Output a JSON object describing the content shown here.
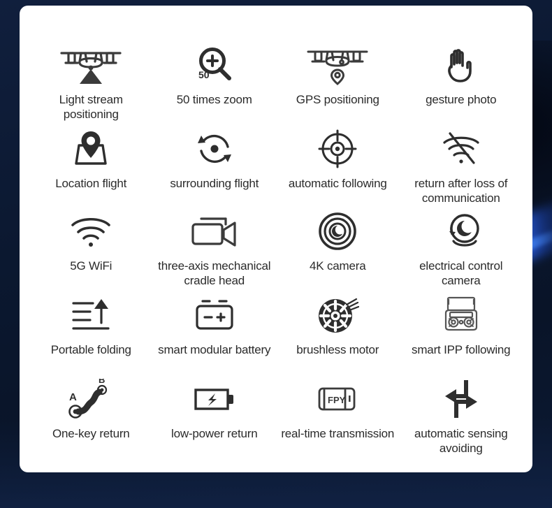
{
  "background": {
    "base_color": "#0c1a33",
    "accent_streak_color": "#2c68ff"
  },
  "card": {
    "background_color": "#ffffff",
    "text_color": "#2b2b2b"
  },
  "features": [
    {
      "icon": "drone-light-beam-icon",
      "label": "Light stream positioning"
    },
    {
      "icon": "magnifier-zoom-50-icon",
      "label": "50 times zoom",
      "badge": "50"
    },
    {
      "icon": "drone-gps-pin-icon",
      "label": "GPS positioning"
    },
    {
      "icon": "open-hand-icon",
      "label": "gesture photo"
    },
    {
      "icon": "map-location-pin-icon",
      "label": "Location flight"
    },
    {
      "icon": "orbit-circular-arrows-icon",
      "label": "surrounding flight"
    },
    {
      "icon": "crosshair-target-icon",
      "label": "automatic following"
    },
    {
      "icon": "wifi-signal-lost-icon",
      "label": "return after loss of communication"
    },
    {
      "icon": "wifi-signal-icon",
      "label": "5G WiFi"
    },
    {
      "icon": "video-camera-icon",
      "label": "three-axis mechanical cradle head"
    },
    {
      "icon": "camera-lens-rings-icon",
      "label": "4K camera"
    },
    {
      "icon": "rotating-camera-eye-icon",
      "label": "electrical control camera"
    },
    {
      "icon": "folding-arrow-up-icon",
      "label": "Portable folding"
    },
    {
      "icon": "battery-terminals-icon",
      "label": "smart modular battery"
    },
    {
      "icon": "brushless-motor-icon",
      "label": "brushless motor"
    },
    {
      "icon": "remote-controller-icon",
      "label": "smart IPP following"
    },
    {
      "icon": "waypoint-a-to-b-icon",
      "label": "One-key return",
      "point_a": "A",
      "point_b": "B"
    },
    {
      "icon": "battery-bolt-icon",
      "label": "low-power return"
    },
    {
      "icon": "fpv-module-icon",
      "label": "real-time transmission",
      "badge": "FPY"
    },
    {
      "icon": "obstacle-avoid-arrows-icon",
      "label": "automatic sensing avoiding"
    }
  ]
}
